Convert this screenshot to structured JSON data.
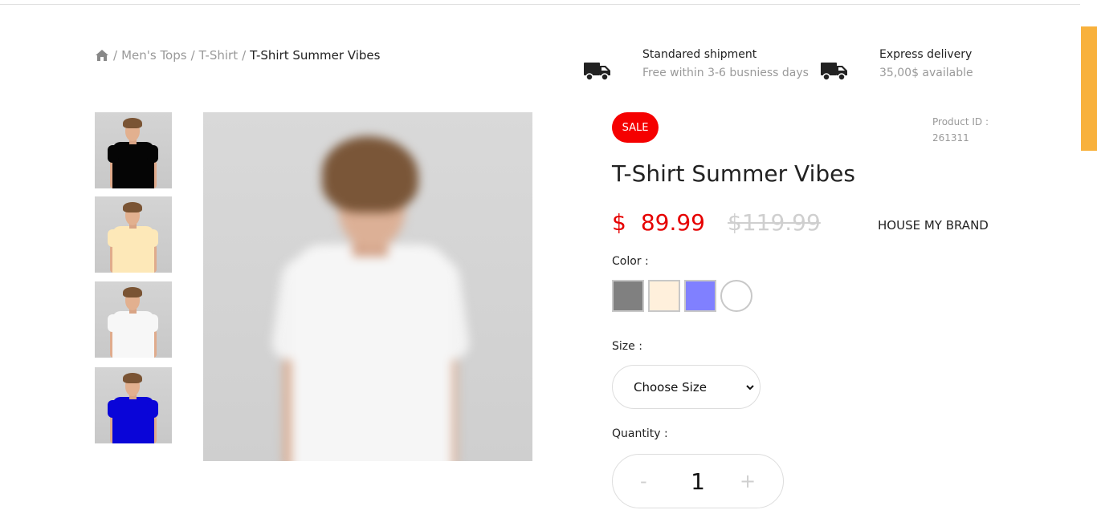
{
  "breadcrumb": {
    "home_icon": "home-icon",
    "separator": "/",
    "items": [
      "Men's Tops",
      "T-Shirt"
    ],
    "current": "T-Shirt Summer Vibes"
  },
  "shipping": [
    {
      "icon": "truck-icon",
      "title": "Standared shipment",
      "subtitle": "Free within 3-6 busniess days"
    },
    {
      "icon": "truck-icon",
      "title": "Express delivery",
      "subtitle": "35,00$ available"
    }
  ],
  "thumbnails": [
    {
      "shirt_color": "#050505"
    },
    {
      "shirt_color": "#fde8b8"
    },
    {
      "shirt_color": "#f7f7f7"
    },
    {
      "shirt_color": "#0a05d8"
    }
  ],
  "product": {
    "badge": "SALE",
    "id_label": "Product ID :",
    "id": "261311",
    "title": "T-Shirt Summer Vibes",
    "currency": "$",
    "price": "89.99",
    "old_price": "$119.99",
    "brand": "HOUSE MY BRAND"
  },
  "color": {
    "label": "Color :",
    "options": [
      "#808080",
      "#fff0dc",
      "#8080ff",
      "#ffffff"
    ]
  },
  "size": {
    "label": "Size :",
    "placeholder": "Choose Size"
  },
  "quantity": {
    "label": "Quantity :",
    "minus": "-",
    "value": "1",
    "plus": "+"
  },
  "colors": {
    "sale": "#f50000",
    "price": "#e60000",
    "scrollbar": "#f8b13c"
  }
}
